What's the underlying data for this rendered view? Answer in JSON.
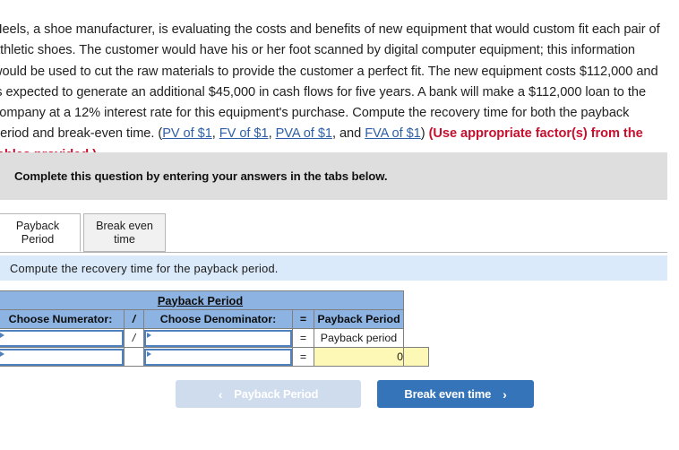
{
  "question": {
    "line1_pre": "Heels, a shoe manufacturer, is evaluating the costs and benefits of new equipment that would custom fit each pair of athletic shoes. The customer would have his or her foot scanned by digital computer equipment; this information would be used to cut the raw materials to provide the customer a perfect fit. The new equipment costs $112,000 and is expected to generate an additional $45,000 in cash flows for five years. A bank will make a $112,000 loan to the company at a 12% interest rate for this equipment's purchase. Compute the recovery time for both the payback period and break-even time. (",
    "link_pv": "PV of $1",
    "sep1": ", ",
    "link_fv": "FV of $1",
    "sep2": ", ",
    "link_pva": "PVA of $1",
    "sep3": ", and ",
    "link_fva": "FVA of $1",
    "close_paren": ") ",
    "red_note": "(Use appropriate factor(s) from the tables provided.)"
  },
  "banner": {
    "instruction": "Complete this question by entering your answers in the tabs below."
  },
  "tabs": [
    {
      "label_line1": "Payback",
      "label_line2": "Period",
      "active": true
    },
    {
      "label_line1": "Break even",
      "label_line2": "time",
      "active": false
    }
  ],
  "sub_instruction": {
    "text": "Compute the recovery time for the payback period."
  },
  "table": {
    "title": "Payback Period",
    "headers": {
      "numerator": "Choose Numerator:",
      "divider": "/",
      "denominator": "Choose Denominator:",
      "equals": "=",
      "result": "Payback Period"
    },
    "rows": [
      {
        "numerator_value": "",
        "operator": "/",
        "denominator_value": "",
        "equals": "=",
        "result_label": "Payback period"
      },
      {
        "numerator_value": "",
        "operator": "",
        "denominator_value": "",
        "equals": "=",
        "result_value": "0"
      }
    ]
  },
  "nav": {
    "prev_label": "Payback Period",
    "prev_chevron": "‹",
    "next_label": "Break even time",
    "next_chevron": "›"
  },
  "colors": {
    "header_blue": "#8cb3e2",
    "banner_gray": "#dedede",
    "strip_blue": "#dbeafa",
    "answer_yellow": "#fdf8b5",
    "link_blue": "#2d5fa8",
    "red": "#c8102e",
    "button_blue": "#3574b8",
    "button_disabled": "#cfdced"
  }
}
